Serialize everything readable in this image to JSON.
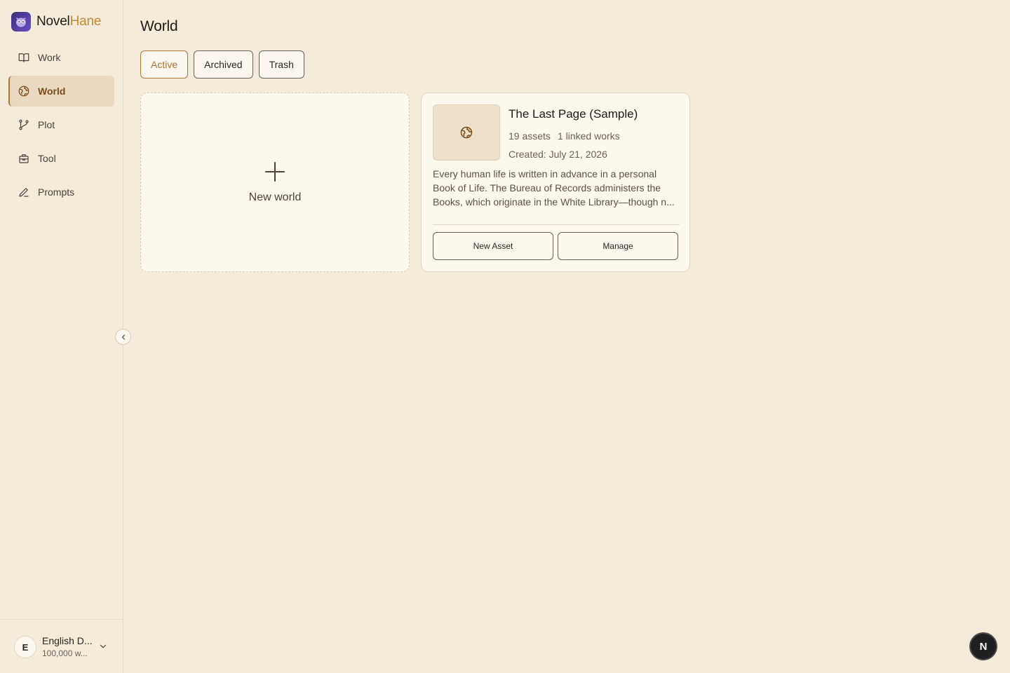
{
  "app": {
    "brand_prefix": "Novel",
    "brand_suffix": "Hane",
    "accent_color": "#a9773a"
  },
  "sidebar": {
    "items": [
      {
        "label": "Work",
        "icon": "book-open-icon",
        "active": false
      },
      {
        "label": "World",
        "icon": "globe-icon",
        "active": true
      },
      {
        "label": "Plot",
        "icon": "git-branch-icon",
        "active": false
      },
      {
        "label": "Tool",
        "icon": "toolbox-icon",
        "active": false
      },
      {
        "label": "Prompts",
        "icon": "pen-icon",
        "active": false
      }
    ],
    "user": {
      "initial": "E",
      "name": "English D...",
      "subtitle": "100,000 w..."
    }
  },
  "main": {
    "title": "World",
    "tabs": [
      {
        "label": "Active",
        "active": true
      },
      {
        "label": "Archived",
        "active": false
      },
      {
        "label": "Trash",
        "active": false
      }
    ],
    "new_world_label": "New world",
    "worlds": [
      {
        "title": "The Last Page (Sample)",
        "assets": "19 assets",
        "linked": "1 linked works",
        "created": "Created: July 21, 2026",
        "description": "Every human life is written in advance in a personal Book of Life. The Bureau of Records administers the Books, which originate in the White Library—though n...",
        "new_asset_label": "New Asset",
        "manage_label": "Manage"
      }
    ]
  },
  "fab": {
    "label": "N"
  }
}
